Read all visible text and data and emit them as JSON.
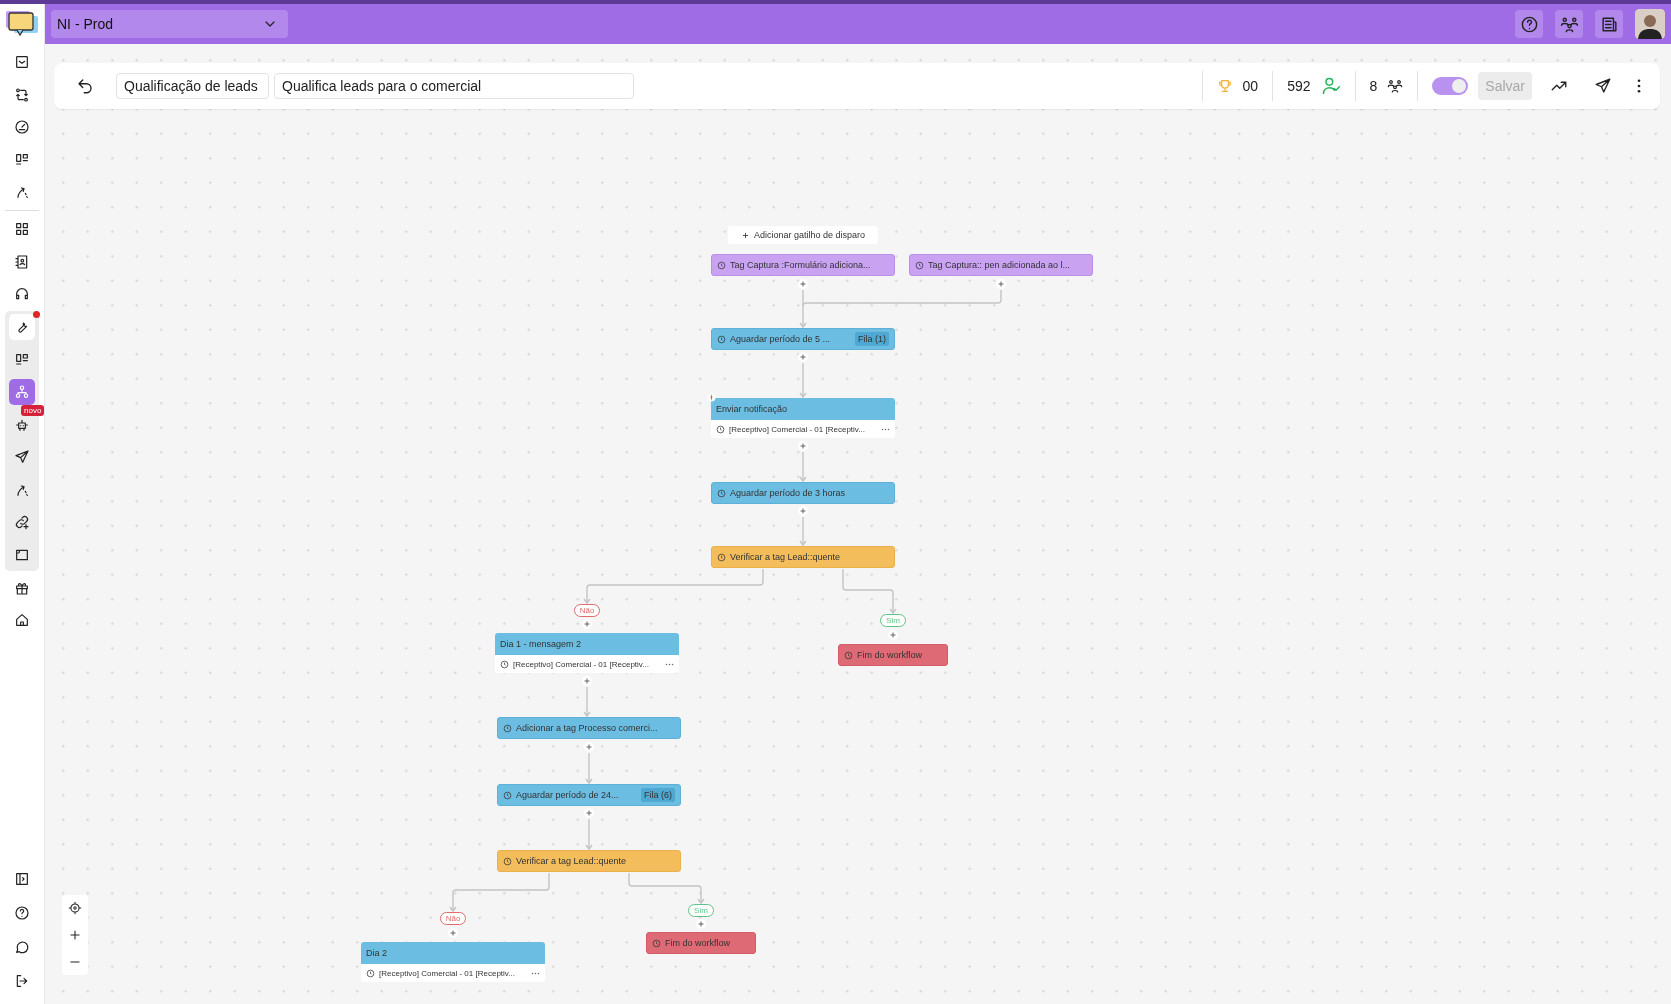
{
  "top_bar": {
    "workspace": "NI - Prod"
  },
  "sidebar": {
    "groups": [
      {
        "highlighted": false,
        "items": [
          {
            "selected": false
          },
          {
            "selected": false
          },
          {
            "selected": false
          },
          {
            "selected": false
          },
          {
            "selected": false
          }
        ]
      },
      {
        "highlighted": false,
        "items": [
          {
            "selected": false
          },
          {
            "selected": false
          },
          {
            "selected": false
          }
        ]
      },
      {
        "highlighted": true,
        "items": [
          {
            "selected": false,
            "notification": true
          },
          {
            "selected": false
          },
          {
            "selected": true
          },
          {
            "selected": false,
            "badge": "novo"
          },
          {
            "selected": false
          },
          {
            "selected": false
          },
          {
            "selected": false
          },
          {
            "selected": false
          }
        ]
      },
      {
        "highlighted": false,
        "items": [
          {
            "selected": false
          },
          {
            "selected": false
          }
        ]
      }
    ],
    "footer_items": [
      {
        "selected": false
      },
      {
        "selected": false
      },
      {
        "selected": false
      },
      {
        "selected": false
      }
    ]
  },
  "toolbar": {
    "name": "Qualificação de leads",
    "description": "Qualifica leads para o comercial",
    "goals": "00",
    "contacts": "592",
    "members": "8",
    "active": true,
    "save": {
      "label": "Salvar",
      "disabled": true
    }
  },
  "workflow": {
    "nodes": [
      {
        "kind": "add_trigger",
        "label": "Adicionar gatilho de disparo"
      },
      {
        "kind": "trigger",
        "label": "Tag Captura :Formulário adiciona..."
      },
      {
        "kind": "trigger",
        "label": "Tag Captura:: pen adicionada ao l..."
      },
      {
        "kind": "wait",
        "label": "Aguardar período de 5 ...",
        "badge": "Fila (1)"
      },
      {
        "kind": "message",
        "label": "Enviar notificação",
        "detail": "[Receptivo] Comercial - 01 [Receptiv...",
        "flagged": true
      },
      {
        "kind": "wait",
        "label": "Aguardar período de 3 horas"
      },
      {
        "kind": "condition",
        "label": "Verificar a tag Lead::quente"
      },
      {
        "kind": "branch",
        "label": "Não",
        "color": "#e06b6b"
      },
      {
        "kind": "branch",
        "label": "Sim",
        "color": "#5cc585"
      },
      {
        "kind": "message",
        "label": "Dia 1 - mensagem 2",
        "detail": "[Receptivo] Comercial - 01 [Receptiv...",
        "flagged": false
      },
      {
        "kind": "end",
        "label": "Fim do workflow"
      },
      {
        "kind": "action",
        "label": "Adicionar a tag Processo comerci..."
      },
      {
        "kind": "wait",
        "label": "Aguardar período de 24...",
        "badge": "Fila (6)"
      },
      {
        "kind": "condition",
        "label": "Verificar a tag Lead::quente"
      },
      {
        "kind": "branch",
        "label": "Não",
        "color": "#e06b6b"
      },
      {
        "kind": "message",
        "label": "Dia 2",
        "detail": "[Receptivo] Comercial - 01 [Receptiv...",
        "flagged": false
      },
      {
        "kind": "branch",
        "label": "Sim",
        "color": "#5cc585"
      },
      {
        "kind": "end",
        "label": "Fim do workflow"
      }
    ]
  }
}
